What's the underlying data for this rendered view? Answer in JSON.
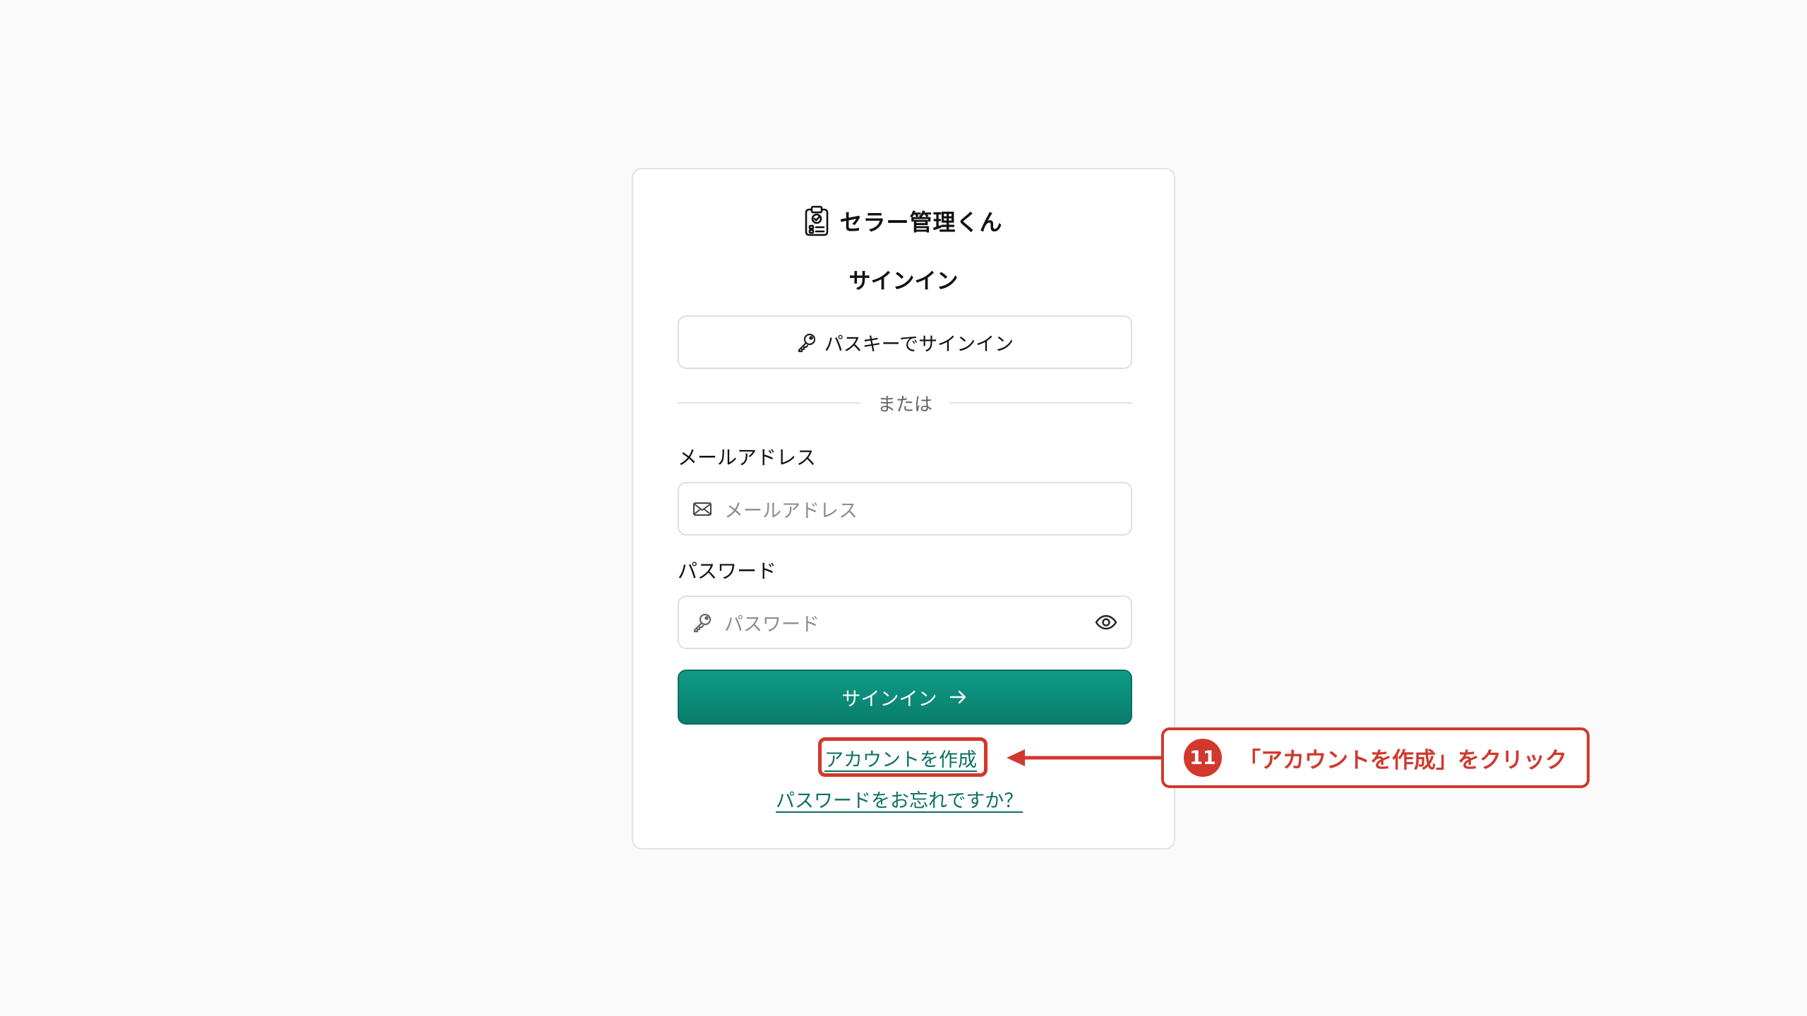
{
  "app": {
    "name": "セラー管理くん",
    "icon": "clipboard-check-icon"
  },
  "signin": {
    "title": "サインイン",
    "passkey_label": "パスキーでサインイン",
    "divider_text": "または",
    "email_label": "メールアドレス",
    "email_placeholder": "メールアドレス",
    "email_value": "",
    "password_label": "パスワード",
    "password_placeholder": "パスワード",
    "password_value": "",
    "submit_label": "サインイン",
    "create_account_link": "アカウントを作成",
    "forgot_password_link": "パスワードをお忘れですか？"
  },
  "annotation": {
    "step_number": "11",
    "text": "「アカウントを作成」をクリック"
  },
  "colors": {
    "primary": "#0a8a77",
    "link": "#0d6f60",
    "annotation": "#d2382c",
    "background": "#fafafa"
  }
}
